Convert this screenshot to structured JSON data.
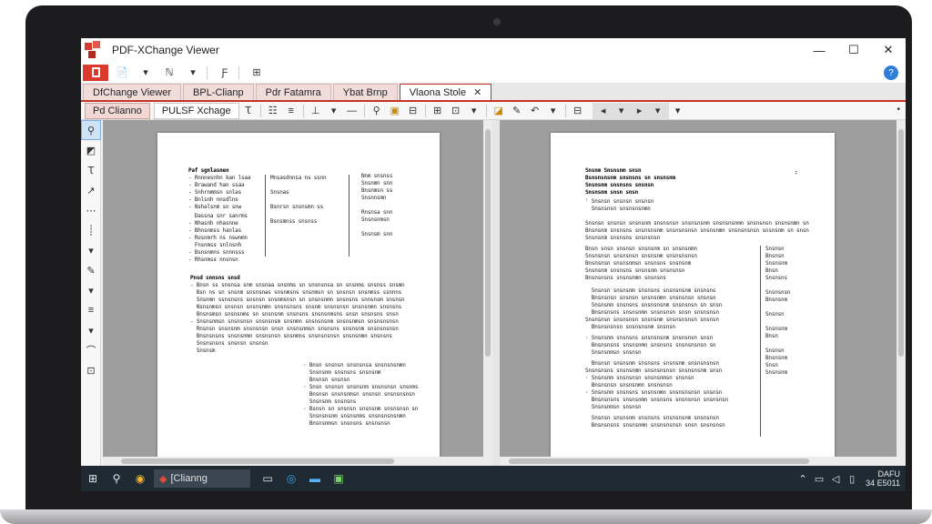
{
  "window": {
    "title": "PDF-XChange Viewer",
    "controls": [
      "—",
      "☐",
      "✕"
    ]
  },
  "quickbar": {
    "icons": [
      "📄",
      "▾",
      "ℕ",
      "▾",
      "Ƒ",
      "⊞"
    ],
    "help_glyph": "?"
  },
  "tabs": [
    {
      "label": "DfChange Viewer",
      "active": false
    },
    {
      "label": "BPL-Clianp",
      "active": false
    },
    {
      "label": "Pdr Fatamra",
      "active": false
    },
    {
      "label": "Ybat Brnp",
      "active": false
    },
    {
      "label": "Vlaona Stole",
      "active": true
    }
  ],
  "ribbon": {
    "tab_one": "Pd Clianno",
    "tab_two": "PULSF Xchage",
    "more_glyph": "•"
  },
  "taskbar": {
    "search_label": "[Clianng",
    "clock_line1": "DAFU",
    "clock_line2": "34 E5011"
  },
  "colors": {
    "accent": "#c63226",
    "taskbar": "#1f2a33",
    "canvas": "#9e9e9e"
  }
}
